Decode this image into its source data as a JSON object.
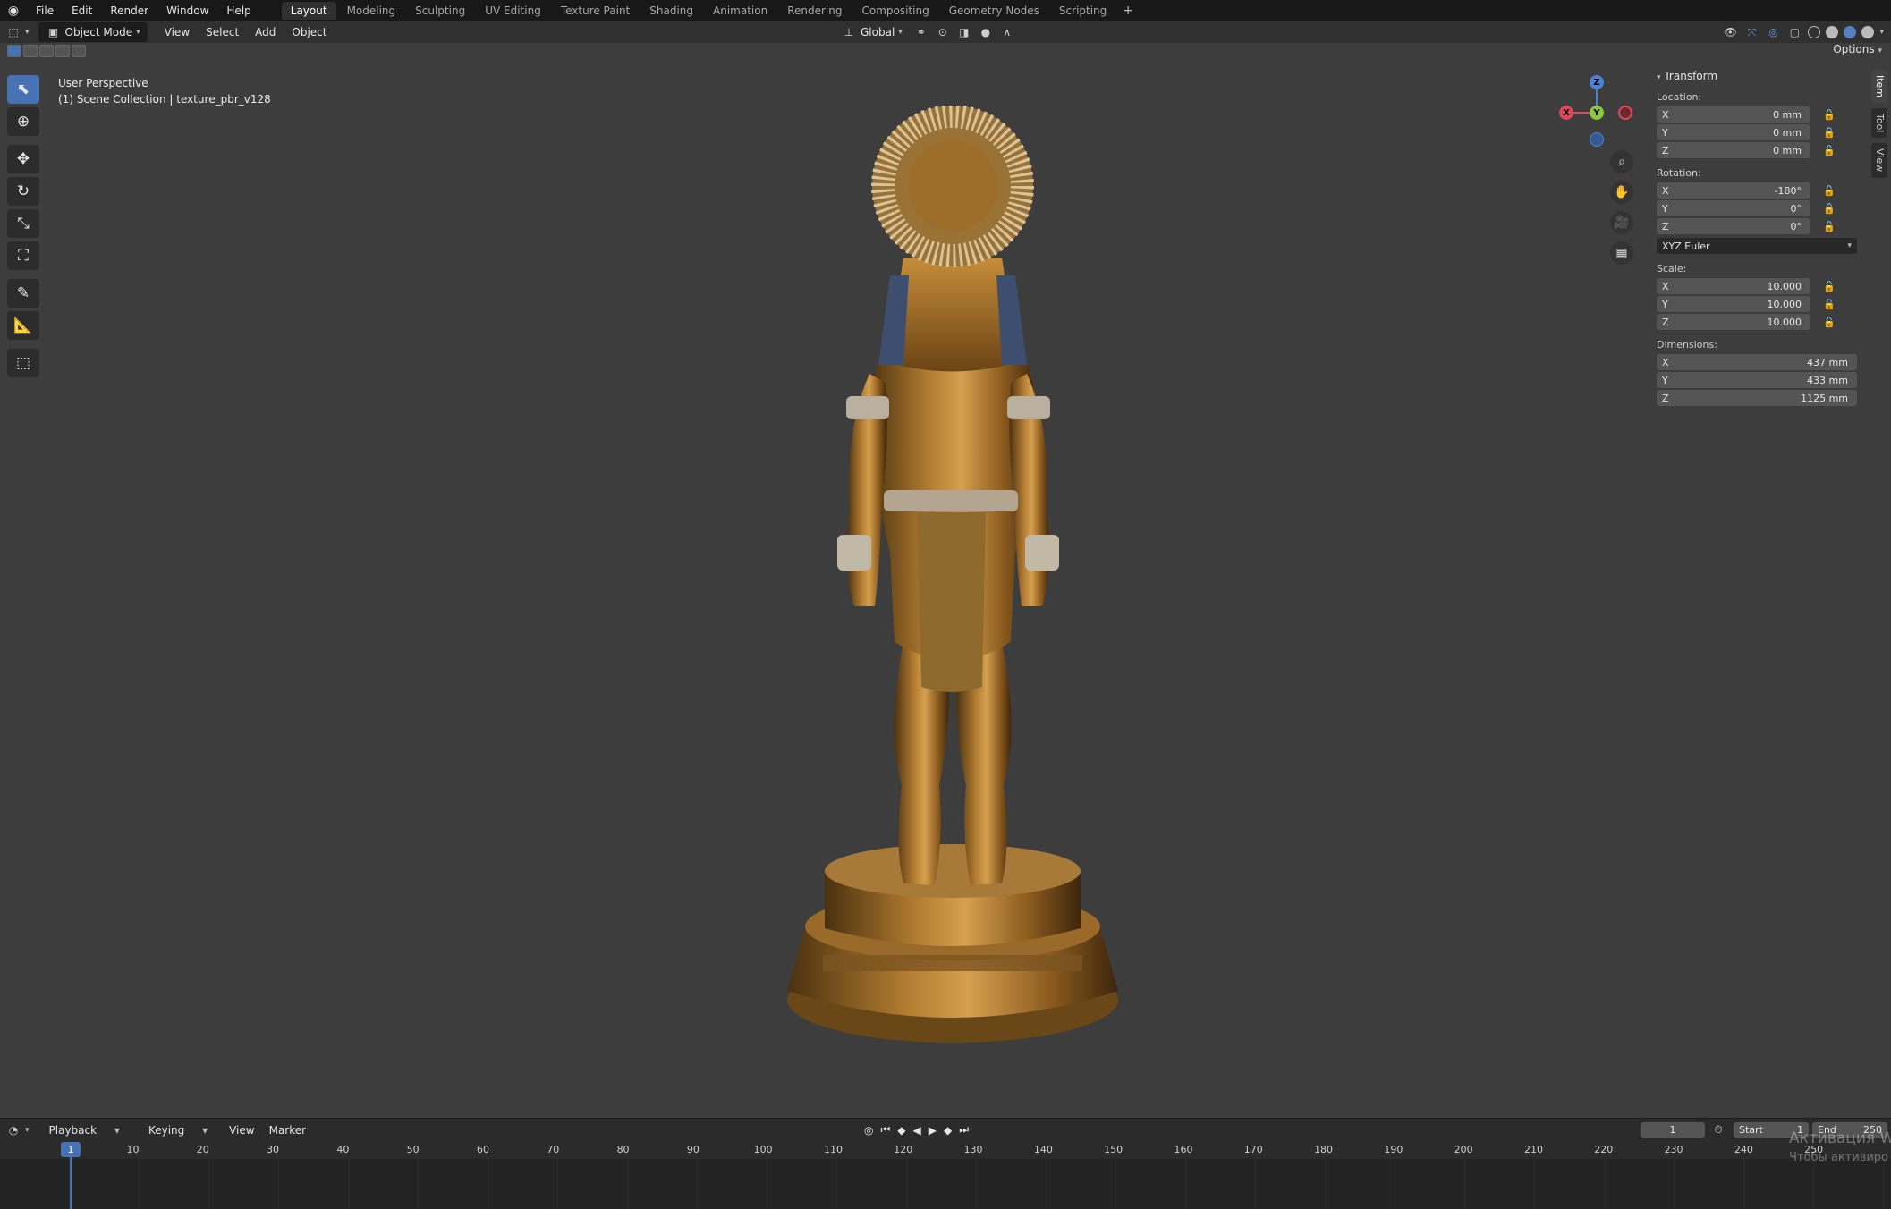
{
  "topbar": {
    "menus": [
      "File",
      "Edit",
      "Render",
      "Window",
      "Help"
    ],
    "workspaces": [
      "Layout",
      "Modeling",
      "Sculpting",
      "UV Editing",
      "Texture Paint",
      "Shading",
      "Animation",
      "Rendering",
      "Compositing",
      "Geometry Nodes",
      "Scripting"
    ],
    "active_workspace": "Layout",
    "add_tab": "+"
  },
  "header": {
    "mode": "Object Mode",
    "menus": [
      "View",
      "Select",
      "Add",
      "Object"
    ],
    "orientation": "Global",
    "options": "Options"
  },
  "viewport": {
    "view_name": "User Perspective",
    "collection": "(1) Scene Collection | texture_pbr_v128"
  },
  "gizmo": {
    "x": "X",
    "y": "Y",
    "z": "Z"
  },
  "npanel": {
    "section": "Transform",
    "location_label": "Location:",
    "location": [
      {
        "axis": "X",
        "value": "0 mm"
      },
      {
        "axis": "Y",
        "value": "0 mm"
      },
      {
        "axis": "Z",
        "value": "0 mm"
      }
    ],
    "rotation_label": "Rotation:",
    "rotation": [
      {
        "axis": "X",
        "value": "-180°"
      },
      {
        "axis": "Y",
        "value": "0°"
      },
      {
        "axis": "Z",
        "value": "0°"
      }
    ],
    "rotation_mode": "XYZ Euler",
    "scale_label": "Scale:",
    "scale": [
      {
        "axis": "X",
        "value": "10.000"
      },
      {
        "axis": "Y",
        "value": "10.000"
      },
      {
        "axis": "Z",
        "value": "10.000"
      }
    ],
    "dimensions_label": "Dimensions:",
    "dimensions": [
      {
        "axis": "X",
        "value": "437 mm"
      },
      {
        "axis": "Y",
        "value": "433 mm"
      },
      {
        "axis": "Z",
        "value": "1125 mm"
      }
    ],
    "tabs": [
      "Item",
      "Tool",
      "View"
    ]
  },
  "timeline": {
    "menus": [
      "Playback",
      "Keying",
      "View",
      "Marker"
    ],
    "current_frame": "1",
    "start_label": "Start",
    "start": "1",
    "end_label": "End",
    "end": "250",
    "ticks": [
      "10",
      "20",
      "30",
      "40",
      "50",
      "60",
      "70",
      "80",
      "90",
      "100",
      "110",
      "120",
      "130",
      "140",
      "150",
      "160",
      "170",
      "180",
      "190",
      "200",
      "210",
      "220",
      "230",
      "240",
      "250"
    ],
    "cursor_frame": "1"
  },
  "watermark": {
    "line1": "Активация W",
    "line2": "Чтобы активиро"
  },
  "colors": {
    "accent": "#4772b3",
    "viewport_bg": "#3d3d3d",
    "axis_x": "#e0475a",
    "axis_y": "#8cc63e",
    "axis_z": "#4c83d6"
  }
}
